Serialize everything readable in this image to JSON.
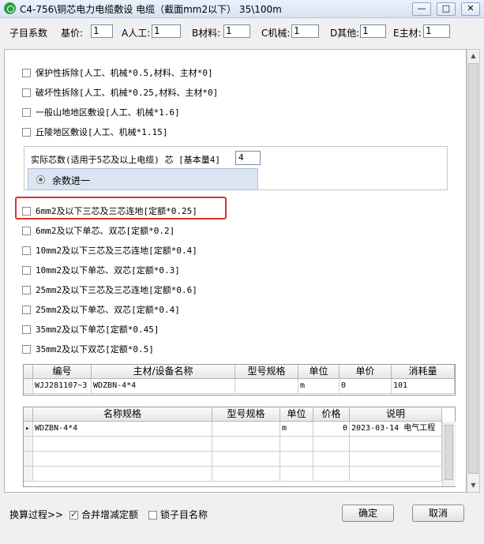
{
  "window": {
    "title": "C4-756\\铜芯电力电缆敷设 电缆（截面mm2以下） 35\\100m",
    "min_label": "—",
    "max_label": "□",
    "close_label": "✕"
  },
  "params": {
    "title": "子目系数",
    "items": [
      {
        "label": "基价:",
        "value": "1"
      },
      {
        "label": "A人工:",
        "value": "1"
      },
      {
        "label": "B材料:",
        "value": "1"
      },
      {
        "label": "C机械:",
        "value": "1"
      },
      {
        "label": "D其他:",
        "value": "1"
      },
      {
        "label": "E主材:",
        "value": "1"
      }
    ]
  },
  "options_top": [
    "保护性拆除[人工、机械*0.5,材料、主材*0]",
    "破坏性拆除[人工、机械*0.25,材料、主材*0]",
    "一般山地地区敷设[人工、机械*1.6]",
    "丘陵地区敷设[人工、机械*1.15]"
  ],
  "core": {
    "label": "实际芯数(适用于5芯及以上电缆) 芯 [基本量4]",
    "value": "4",
    "round_label": "余数进一"
  },
  "options_bottom": [
    "6mm2及以下三芯及三芯连地[定额*0.25]",
    "6mm2及以下单芯、双芯[定额*0.2]",
    "10mm2及以下三芯及三芯连地[定额*0.4]",
    "10mm2及以下单芯、双芯[定额*0.3]",
    "25mm2及以下三芯及三芯连地[定额*0.6]",
    "25mm2及以下单芯、双芯[定额*0.4]",
    "35mm2及以下单芯[定额*0.45]",
    "35mm2及以下双芯[定额*0.5]"
  ],
  "material_table": {
    "headers": [
      "编号",
      "主材/设备名称",
      "型号规格",
      "单位",
      "单价",
      "消耗量"
    ],
    "row": [
      "WJJ281107~3",
      "WDZBN-4*4",
      "",
      "m",
      "0",
      "101"
    ]
  },
  "spec_table": {
    "headers": [
      "名称规格",
      "型号规格",
      "单位",
      "价格",
      "说明"
    ],
    "row": [
      "WDZBN-4*4",
      "",
      "m",
      "0",
      "2023-03-14 电气工程"
    ],
    "row_marker": "▸"
  },
  "footer": {
    "calc_label": "换算过程>>",
    "merge_label": "合并增减定额",
    "lock_label": "锁子目名称",
    "ok_label": "确定",
    "cancel_label": "取消"
  }
}
